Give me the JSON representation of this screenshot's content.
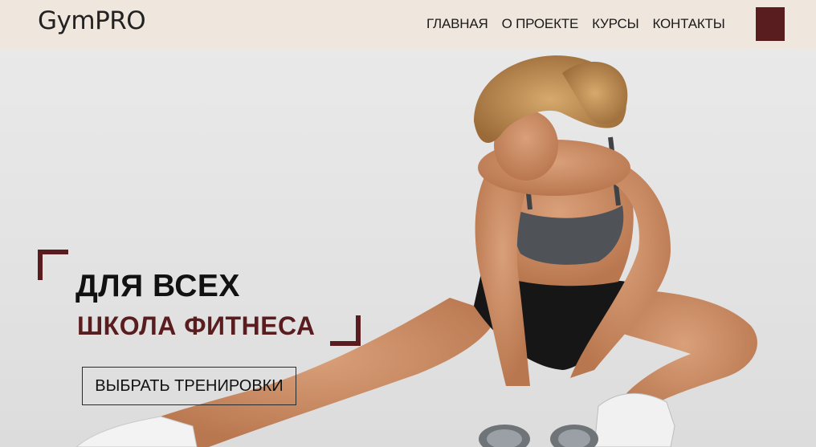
{
  "header": {
    "logo": "GymPRO",
    "nav": [
      "ГЛАВНАЯ",
      "О ПРОЕКТЕ",
      "КУРСЫ",
      "КОНТАКТЫ"
    ],
    "menu_icon": "menu-square-icon"
  },
  "hero": {
    "title": "ДЛЯ ВСЕХ",
    "subtitle": "ШКОЛА ФИТНЕСА",
    "cta_label": "ВЫБРАТЬ ТРЕНИРОВКИ"
  },
  "colors": {
    "accent": "#5a1d1f",
    "header_bg": "#efe6dd",
    "hero_bg": "#e6e6e6"
  }
}
